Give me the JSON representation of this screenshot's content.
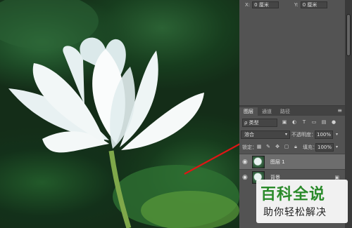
{
  "coords": {
    "x_label": "X:",
    "x_value": "0 厘米",
    "y_label": "Y:",
    "y_value": "0 厘米"
  },
  "layers_panel": {
    "tabs": [
      {
        "label": "图层"
      },
      {
        "label": "通道"
      },
      {
        "label": "路径"
      }
    ],
    "menu_icon": "≡",
    "filter": {
      "label": "ρ 类型",
      "icons": [
        "image-filter-icon",
        "adjustment-filter-icon",
        "type-filter-icon",
        "shape-filter-icon",
        "smart-object-filter-icon"
      ]
    },
    "blend_mode": "溶合",
    "opacity_label": "不透明度：",
    "opacity_value": "100%",
    "lock_label": "锁定：",
    "fill_label": "填充：",
    "fill_value": "100%",
    "layers": [
      {
        "name": "图层 1",
        "selected": true,
        "locked": false
      },
      {
        "name": "背景",
        "selected": false,
        "locked": true
      }
    ]
  },
  "watermark": {
    "title": "百科全说",
    "subtitle": "助你轻松解决"
  },
  "colors": {
    "panel": "#535353",
    "arrow": "#e01515",
    "watermark_green": "#2a8a2a"
  }
}
